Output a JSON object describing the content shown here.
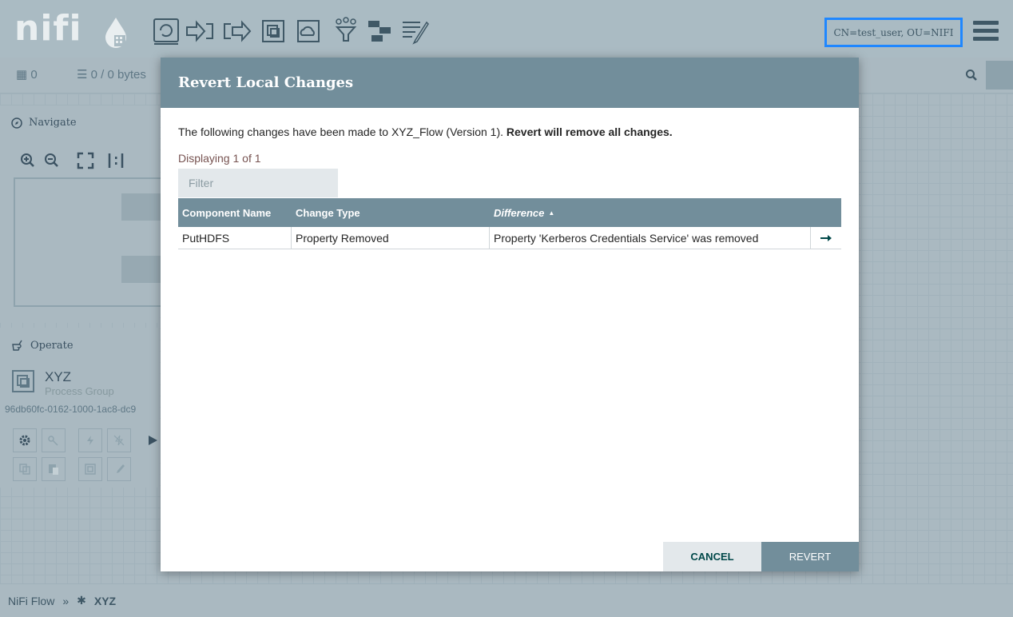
{
  "header": {
    "logo_text": "nifi",
    "user_identity": "CN=test_user, OU=NIFI",
    "toolbar": [
      {
        "name": "processor-icon"
      },
      {
        "name": "input-port-icon"
      },
      {
        "name": "output-port-icon"
      },
      {
        "name": "process-group-icon"
      },
      {
        "name": "remote-process-group-icon"
      },
      {
        "name": "funnel-icon"
      },
      {
        "name": "template-icon"
      },
      {
        "name": "label-icon"
      }
    ]
  },
  "stats": {
    "threads": "0",
    "queued": "0 / 0 bytes"
  },
  "navigate": {
    "title": "Navigate"
  },
  "operate": {
    "title": "Operate",
    "component_name": "XYZ",
    "component_type": "Process Group",
    "component_id": "96db60fc-0162-1000-1ac8-dc9"
  },
  "breadcrumb": {
    "root": "NiFi Flow",
    "separator": "»",
    "current": "XYZ"
  },
  "dialog": {
    "title": "Revert Local Changes",
    "intro_prefix": "The following changes have been made to XYZ_Flow (Version 1). ",
    "intro_bold": "Revert will remove all changes.",
    "displaying": "Displaying 1 of 1",
    "filter_placeholder": "Filter",
    "columns": {
      "component_name": "Component Name",
      "change_type": "Change Type",
      "difference": "Difference"
    },
    "rows": [
      {
        "component_name": "PutHDFS",
        "change_type": "Property Removed",
        "difference": "Property 'Kerberos Credentials Service' was removed"
      }
    ],
    "cancel_label": "CANCEL",
    "revert_label": "REVERT"
  },
  "colors": {
    "header_bg": "#aabbc3",
    "dialog_header": "#728e9b",
    "highlight_border": "#1f87ff"
  }
}
